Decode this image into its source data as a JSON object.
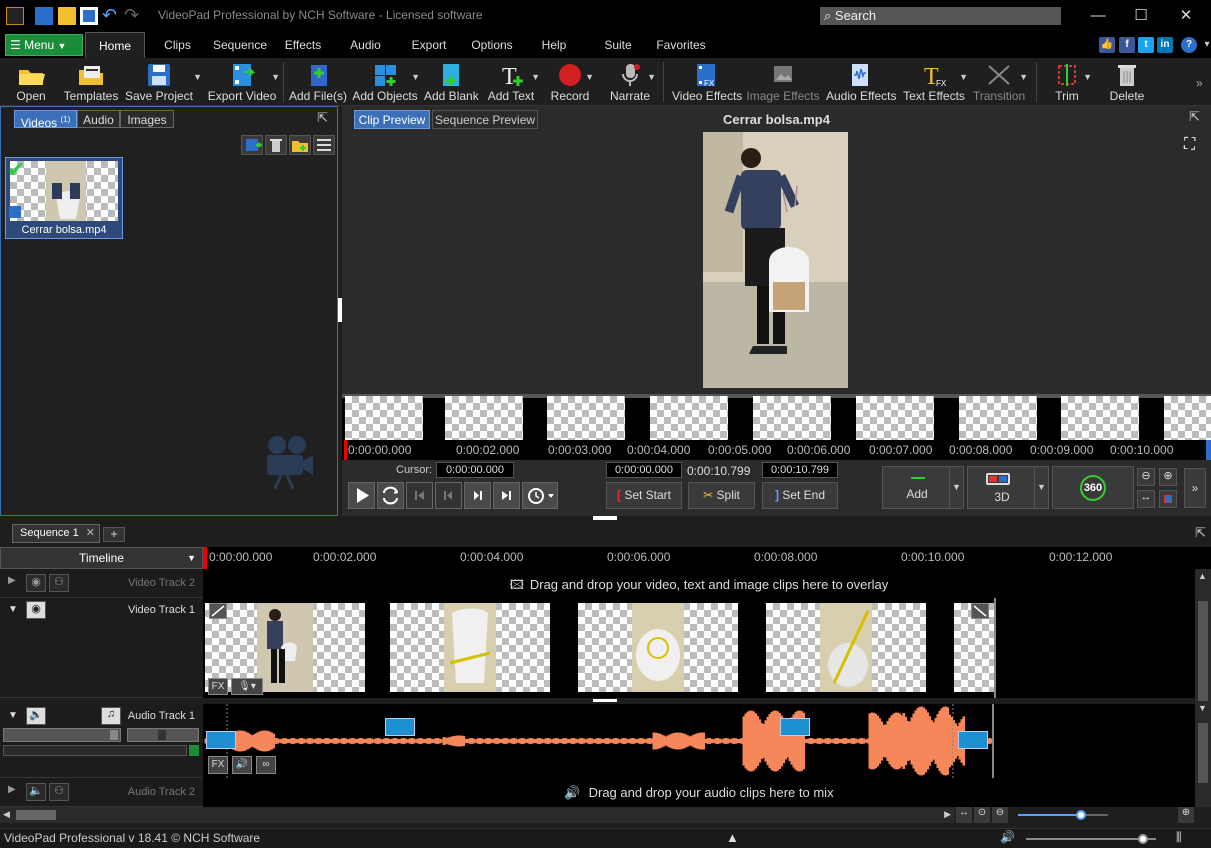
{
  "window": {
    "title": "VideoPad Professional by NCH Software - Licensed software",
    "search_placeholder": "Search"
  },
  "menu_button": "Menu",
  "tabs": [
    "Home",
    "Clips",
    "Sequence",
    "Effects",
    "Audio",
    "Export",
    "Options",
    "Help",
    "Suite",
    "Favorites"
  ],
  "toolbar": {
    "open": "Open",
    "templates": "Templates",
    "save_project": "Save Project",
    "export_video": "Export Video",
    "add_files": "Add File(s)",
    "add_objects": "Add Objects",
    "add_blank": "Add Blank",
    "add_text": "Add Text",
    "record": "Record",
    "narrate": "Narrate",
    "video_effects": "Video Effects",
    "image_effects": "Image Effects",
    "audio_effects": "Audio Effects",
    "text_effects": "Text Effects",
    "transition": "Transition",
    "trim": "Trim",
    "delete": "Delete"
  },
  "bin": {
    "tabs": {
      "videos": "Videos",
      "videos_count": "(1)",
      "audio": "Audio",
      "images": "Images"
    },
    "clip_name": "Cerrar bolsa.mp4"
  },
  "preview": {
    "clip_tab": "Clip Preview",
    "sequence_tab": "Sequence Preview",
    "title": "Cerrar bolsa.mp4",
    "ruler": [
      "0:00:00.000",
      "0:00:02.000",
      "0:00:03.000",
      "0:00:04.000",
      "0:00:05.000",
      "0:00:06.000",
      "0:00:07.000",
      "0:00:08.000",
      "0:00:09.000",
      "0:00:10.000"
    ],
    "cursor_label": "Cursor:",
    "cursor_value": "0:00:00.000",
    "start_value": "0:00:00.000",
    "duration_value": "0:00:10.799",
    "end_value": "0:00:10.799",
    "set_start": "Set Start",
    "split": "Split",
    "set_end": "Set End",
    "add": "Add",
    "three_d": "3D",
    "three60": "360"
  },
  "timeline": {
    "sequence_tab": "Sequence 1",
    "header": "Timeline",
    "ruler": [
      "0:00:00.000",
      "0:00:02.000",
      "0:00:04.000",
      "0:00:06.000",
      "0:00:08.000",
      "0:00:10.000",
      "0:00:12.000"
    ],
    "video_track_2": "Video Track 2",
    "video_track_1": "Video Track 1",
    "audio_track_1": "Audio Track 1",
    "audio_track_2": "Audio Track 2",
    "overlay_hint": "Drag and drop your video, text and image clips here to overlay",
    "mix_hint": "Drag and drop your audio clips here to mix",
    "fx": "FX",
    "zoom_level": 0.7,
    "volume_level": 0.9
  },
  "status": "VideoPad Professional v 18.41 © NCH Software",
  "colors": {
    "accent": "#3b6fb8",
    "waveform": "#f5875a",
    "menu_green": "#1a8c3a",
    "playhead": "#e00000"
  }
}
